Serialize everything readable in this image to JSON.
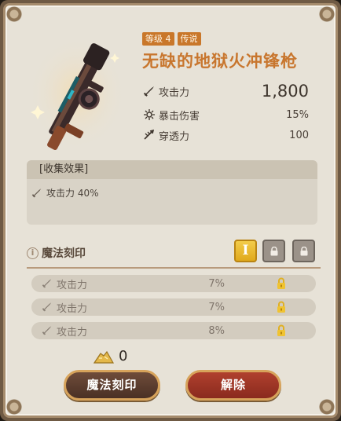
{
  "item": {
    "level_badge": "等级 4",
    "rarity_badge": "传说",
    "name": "无缺的地狱火冲锋枪"
  },
  "stats": [
    {
      "icon": "sword-icon",
      "label": "攻击力",
      "value": "1,800"
    },
    {
      "icon": "crit-burst-icon",
      "label": "暴击伤害",
      "value": "15%"
    },
    {
      "icon": "pierce-icon",
      "label": "穿透力",
      "value": "100"
    }
  ],
  "collection": {
    "title": "[收集效果]",
    "effect": "攻击力 40%"
  },
  "enchant": {
    "title": "魔法刻印",
    "slots": [
      {
        "state": "active",
        "label": "I"
      },
      {
        "state": "locked"
      },
      {
        "state": "locked"
      }
    ],
    "runes": [
      {
        "label": "攻击力",
        "value": "7%"
      },
      {
        "label": "攻击力",
        "value": "7%"
      },
      {
        "label": "攻击力",
        "value": "8%"
      }
    ]
  },
  "currency": {
    "icon": "powder-pile-icon",
    "amount": "0"
  },
  "buttons": {
    "enchant_label": "魔法刻印",
    "remove_label": "解除"
  },
  "colors": {
    "title_orange": "#c8762e",
    "badge_orange": "#c9772a",
    "slot_gold": "#e8b52a",
    "panel_bg": "#e7e2d7"
  }
}
